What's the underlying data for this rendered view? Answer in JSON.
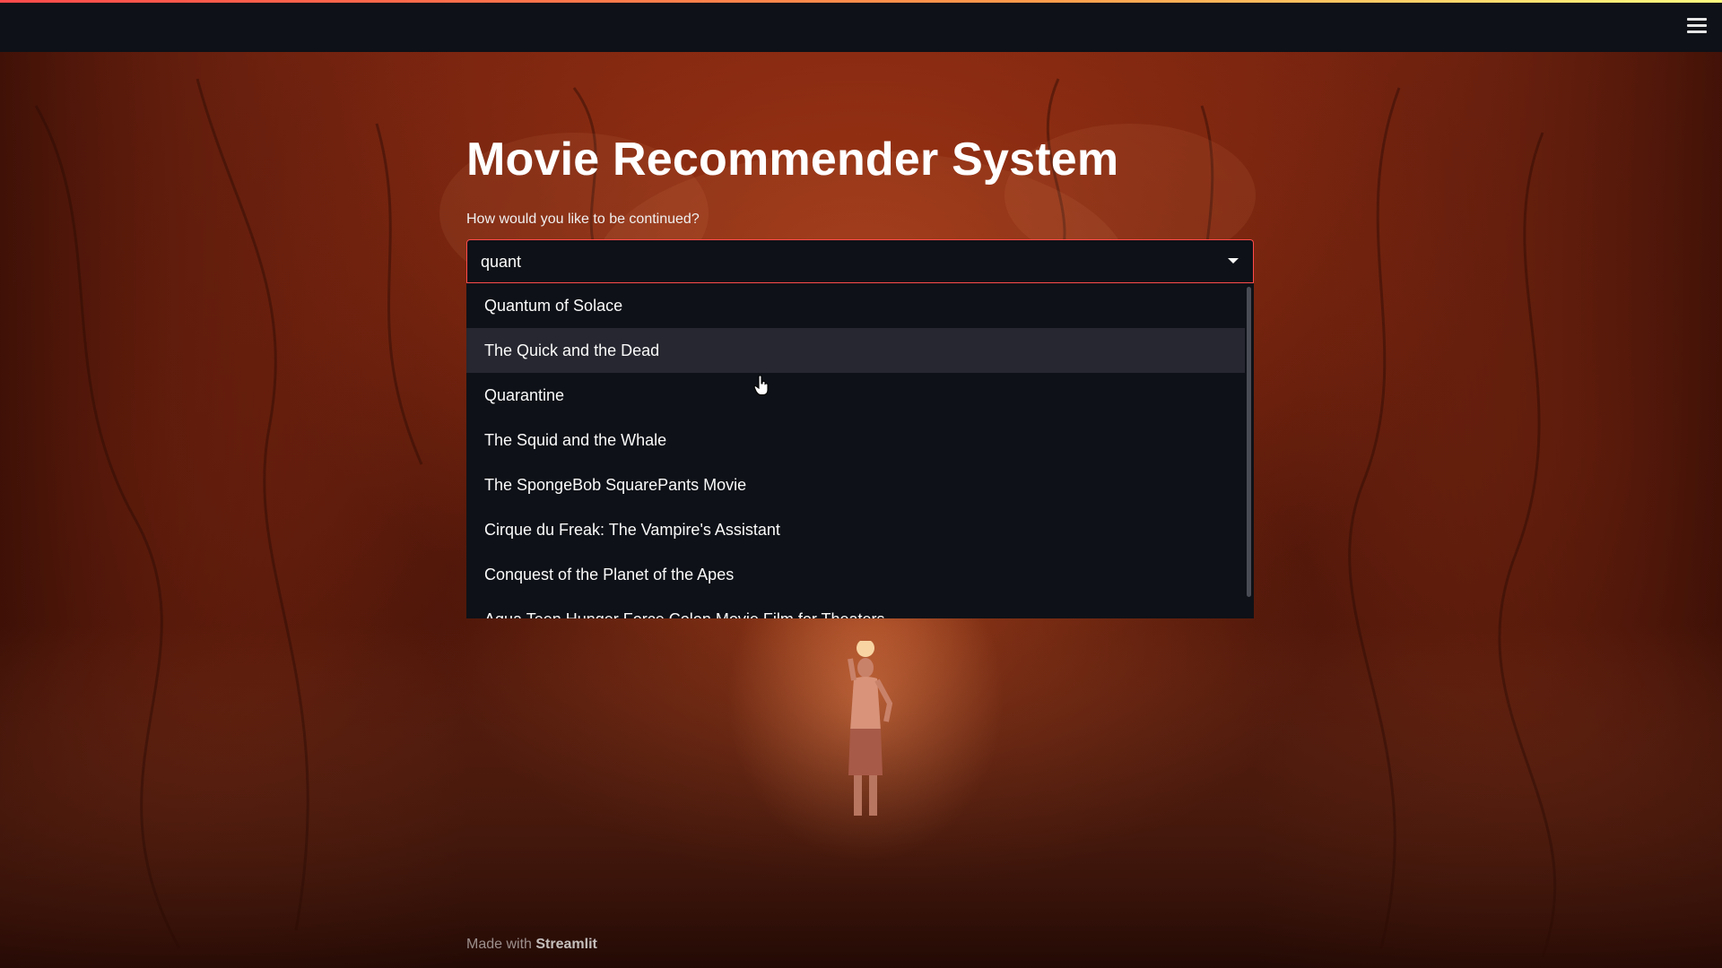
{
  "header": {
    "menu_icon": "hamburger-menu-icon"
  },
  "main": {
    "title": "Movie Recommender System",
    "select_label": "How would you like to be continued?",
    "select_value": "quant",
    "options": [
      "Quantum of Solace",
      "The Quick and the Dead",
      "Quarantine",
      "The Squid and the Whale",
      "The SpongeBob SquarePants Movie",
      "Cirque du Freak: The Vampire's Assistant",
      "Conquest of the Planet of the Apes",
      "Aqua Teen Hunger Force Colon Movie Film for Theaters"
    ],
    "hovered_option": "The Quick and the Dead"
  },
  "footer": {
    "prefix": "Made with",
    "brand": "Streamlit"
  },
  "colors": {
    "topbar_bg": "#0e1117",
    "focus_border": "#ff4b4b",
    "option_hover_bg": "#262730"
  }
}
